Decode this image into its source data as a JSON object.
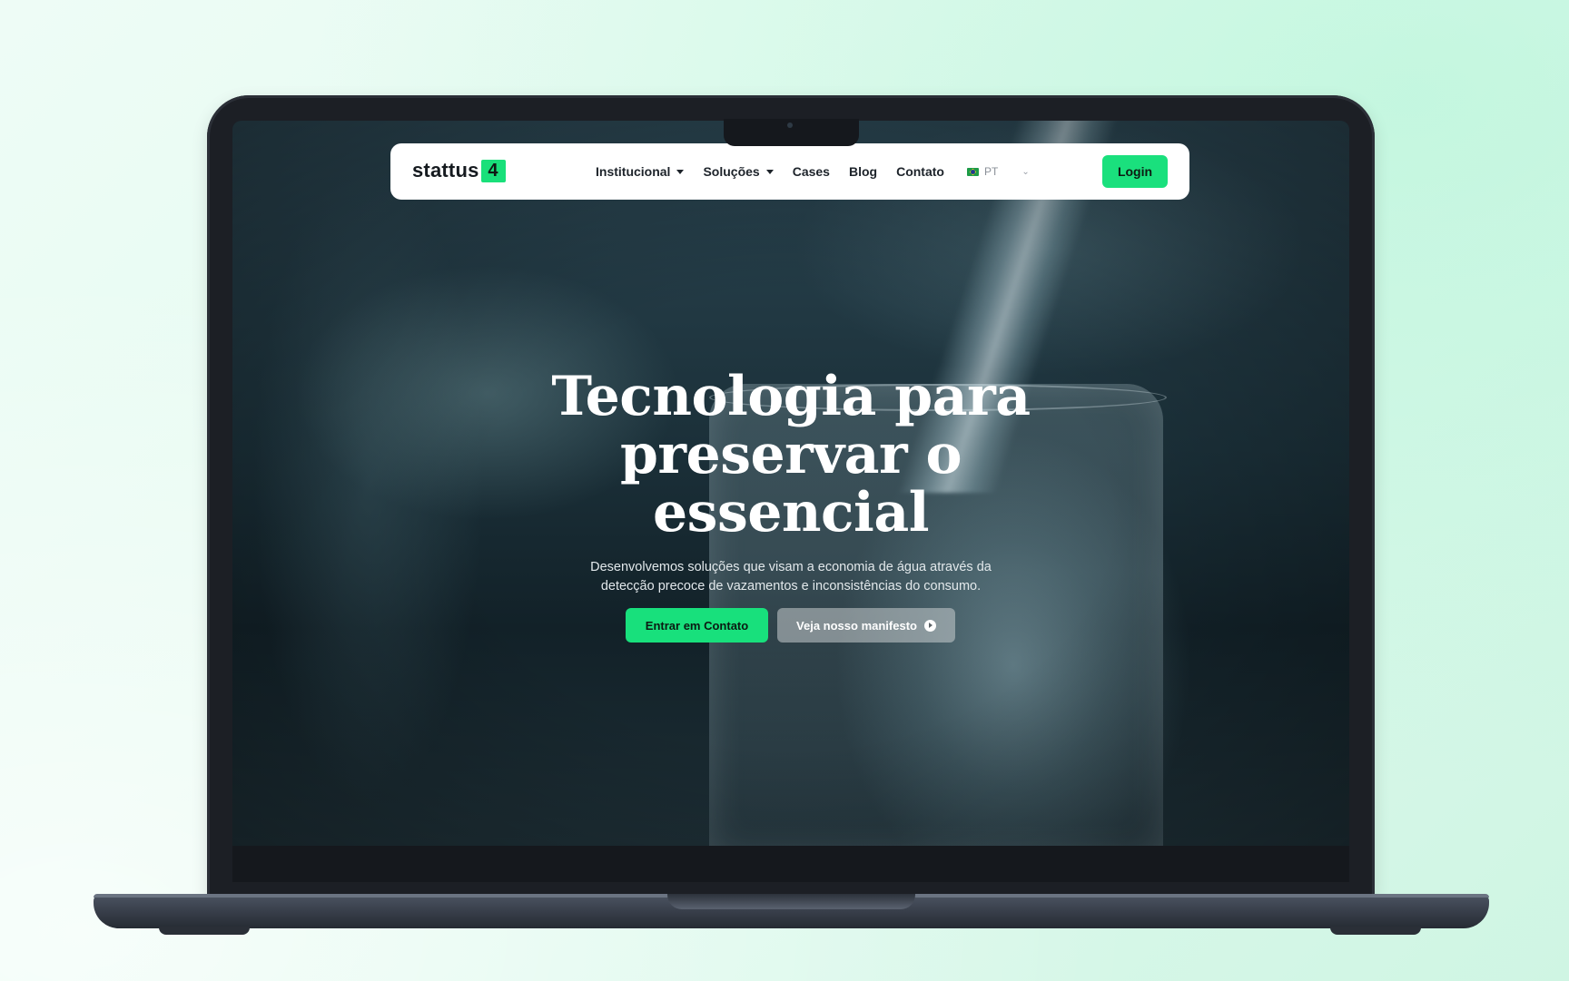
{
  "colors": {
    "accent": "#19e07a",
    "background": "#e4fbf1",
    "laptop_frame": "#1c1f25"
  },
  "nav": {
    "logo_text": "stattus",
    "logo_mark": "4",
    "items": [
      {
        "label": "Institucional",
        "dropdown": true
      },
      {
        "label": "Soluções",
        "dropdown": true
      },
      {
        "label": "Cases",
        "dropdown": false
      },
      {
        "label": "Blog",
        "dropdown": false
      },
      {
        "label": "Contato",
        "dropdown": false
      }
    ],
    "language": {
      "code": "PT",
      "flag_icon": "brazil-flag-icon"
    },
    "login_label": "Login"
  },
  "hero": {
    "title_lines": [
      "Tecnologia para",
      "preservar o",
      "essencial"
    ],
    "subtitle_lines": [
      "Desenvolvemos soluções que visam a economia de água através da",
      "detecção precoce de vazamentos e inconsistências do consumo."
    ],
    "primary_button": "Entrar em Contato",
    "secondary_button": "Veja nosso manifesto"
  }
}
